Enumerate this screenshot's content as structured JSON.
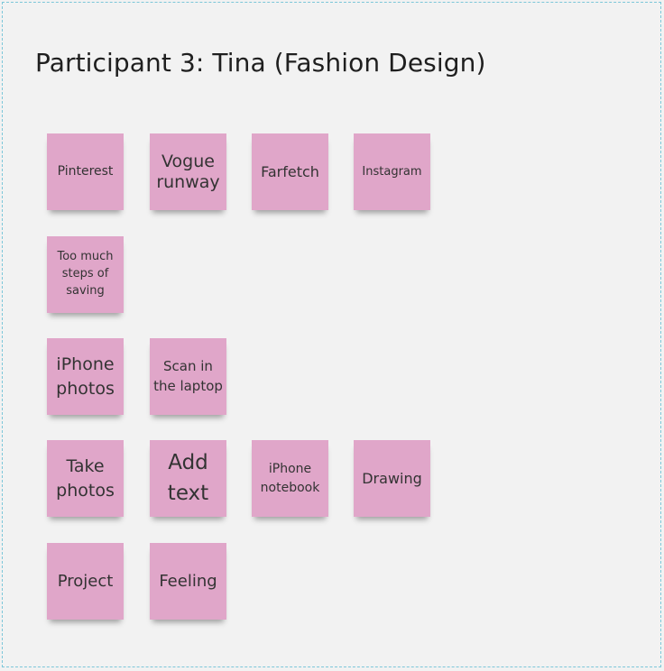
{
  "board": {
    "title": "Participant 3: Tina (Fashion Design)"
  },
  "colors": {
    "sticky": "#e0a6c9",
    "frame_border": "#7cc7d9",
    "background": "#f2f2f2"
  },
  "stickies": [
    {
      "id": "pinterest",
      "text": "Pinterest"
    },
    {
      "id": "vogue-runway",
      "text": "Vogue runway"
    },
    {
      "id": "farfetch",
      "text": "Farfetch"
    },
    {
      "id": "instagram",
      "text": "Instagram"
    },
    {
      "id": "too-much-steps",
      "text": "Too much steps of saving"
    },
    {
      "id": "iphone-photos",
      "text": "iPhone photos"
    },
    {
      "id": "scan-in-laptop",
      "text": "Scan in the laptop"
    },
    {
      "id": "take-photos",
      "text": "Take photos"
    },
    {
      "id": "add-text",
      "text": "Add text"
    },
    {
      "id": "iphone-notebook",
      "text": "iPhone notebook"
    },
    {
      "id": "drawing",
      "text": "Drawing"
    },
    {
      "id": "project",
      "text": "Project"
    },
    {
      "id": "feeling",
      "text": "Feeling"
    }
  ]
}
